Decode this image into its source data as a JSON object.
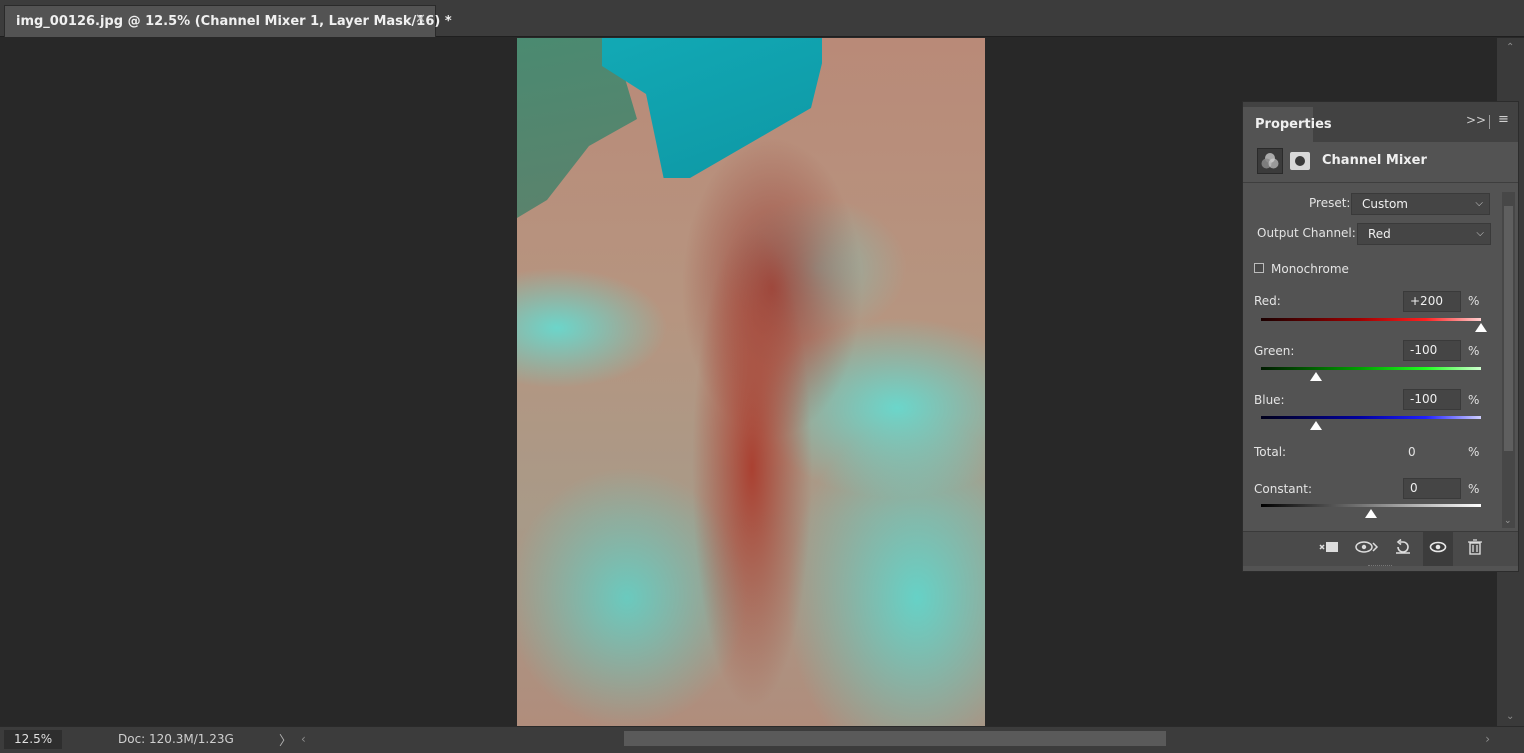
{
  "document_tab": {
    "title": "img_00126.jpg @ 12.5% (Channel Mixer 1, Layer Mask/16) *",
    "close_icon": "close-icon"
  },
  "status_bar": {
    "zoom": "12.5%",
    "doc_info": "Doc: 120.3M/1.23G",
    "arrow": "〉"
  },
  "properties_panel": {
    "tab_label": "Properties",
    "collapse_glyph": ">>",
    "menu_glyph": "≡",
    "adjustment_title": "Channel Mixer",
    "preset_label": "Preset:",
    "preset_value": "Custom",
    "output_channel_label": "Output Channel:",
    "output_channel_value": "Red",
    "monochrome_label": "Monochrome",
    "monochrome_checked": false,
    "sliders": [
      {
        "label": "Red:",
        "value": "+200",
        "pct": "%",
        "fraction": 1.0
      },
      {
        "label": "Green:",
        "value": "-100",
        "pct": "%",
        "fraction": 0.25
      },
      {
        "label": "Blue:",
        "value": "-100",
        "pct": "%",
        "fraction": 0.25
      }
    ],
    "total_label": "Total:",
    "total_value": "0",
    "total_pct": "%",
    "constant_label": "Constant:",
    "constant_value": "0",
    "constant_pct": "%",
    "constant_fraction": 0.5,
    "footer_icons": [
      "clip-to-layer-icon",
      "view-previous-state-icon",
      "reset-icon",
      "visibility-eye-icon",
      "trash-icon"
    ]
  },
  "colors": {
    "workspace": "#282828",
    "panel": "#535353",
    "tab_active": "#535353"
  }
}
